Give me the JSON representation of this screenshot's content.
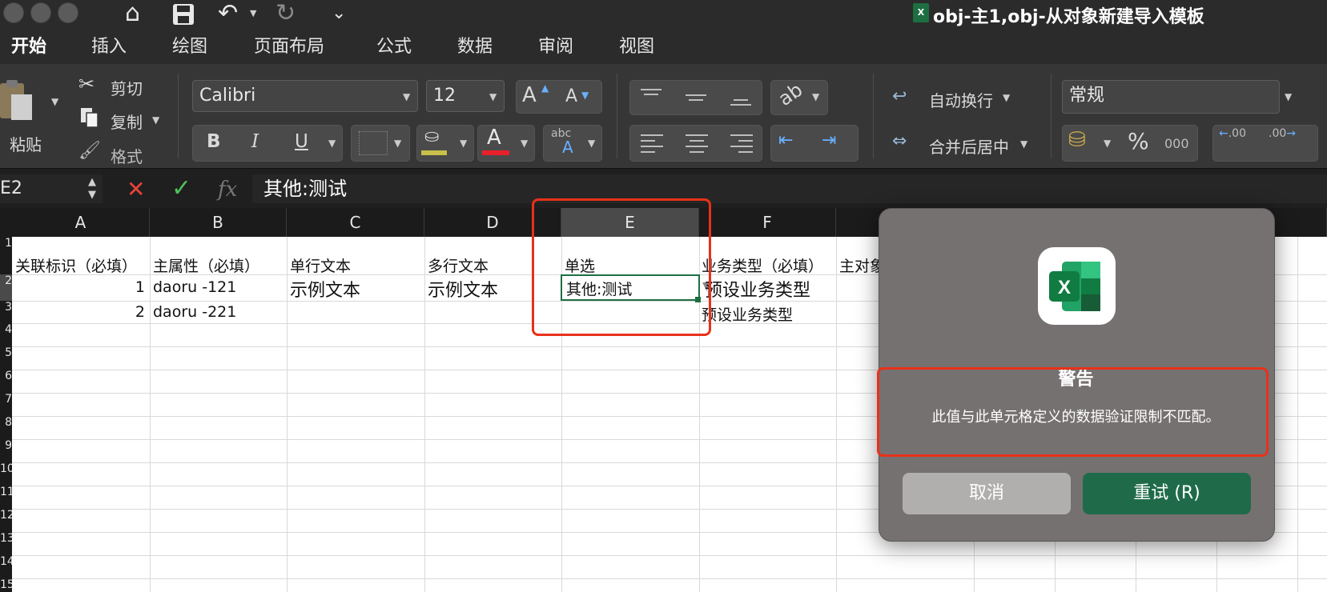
{
  "window": {
    "title": "obj-主1,obj-从对象新建导入模板",
    "file_icon": "X"
  },
  "quick_access": {
    "home_icon": "⌂",
    "save_icon": "💾",
    "undo_icon": "↶",
    "redo_icon": "↻",
    "more_icon": "⌄"
  },
  "tabs": [
    "开始",
    "插入",
    "绘图",
    "页面布局",
    "公式",
    "数据",
    "审阅",
    "视图"
  ],
  "ribbon": {
    "paste": "粘贴",
    "cut": "剪切",
    "copy": "复制",
    "format_painter": "格式",
    "font_name": "Calibri",
    "font_size": "12",
    "grow_font": "A",
    "shrink_font": "A",
    "bold": "B",
    "italic": "I",
    "underline": "U",
    "font_color_glyph": "A",
    "phonetic_top": "abc",
    "phonetic_bottom": "A",
    "wrap_text": "自动换行",
    "merge_center": "合并后居中",
    "number_format": "常规",
    "percent": "%",
    "thousands": "000",
    "inc_decimal": ".00",
    "dec_decimal": ".00"
  },
  "formula_bar": {
    "name_box": "E2",
    "cancel_glyph": "✕",
    "enter_glyph": "✓",
    "fx_glyph": "fx",
    "value": "其他:测试"
  },
  "columns": [
    "A",
    "B",
    "C",
    "D",
    "E",
    "F"
  ],
  "row_numbers": [
    "1",
    "2",
    "3",
    "4",
    "5",
    "6",
    "7",
    "8",
    "9",
    "10",
    "11",
    "12",
    "13",
    "14",
    "15"
  ],
  "cells": {
    "A1": "关联标识（必填）",
    "B1": "主属性（必填）",
    "C1": "单行文本",
    "D1": "多行文本",
    "E1": "单选",
    "F1": "业务类型（必填）",
    "G1": "主对象",
    "A2": "1",
    "B2": "daoru -121",
    "C2": "示例文本",
    "D2": "示例文本",
    "E2": "其他:测试",
    "F2": "预设业务类型",
    "A3": "2",
    "B3": "daoru -221",
    "F3": "预设业务类型"
  },
  "dialog": {
    "title": "警告",
    "message": "此值与此单元格定义的数据验证限制不匹配。",
    "cancel_label": "取消",
    "retry_label": "重试 (R)"
  },
  "colors": {
    "excel_green": "#1d6f42",
    "highlight_red": "#e8311a"
  }
}
